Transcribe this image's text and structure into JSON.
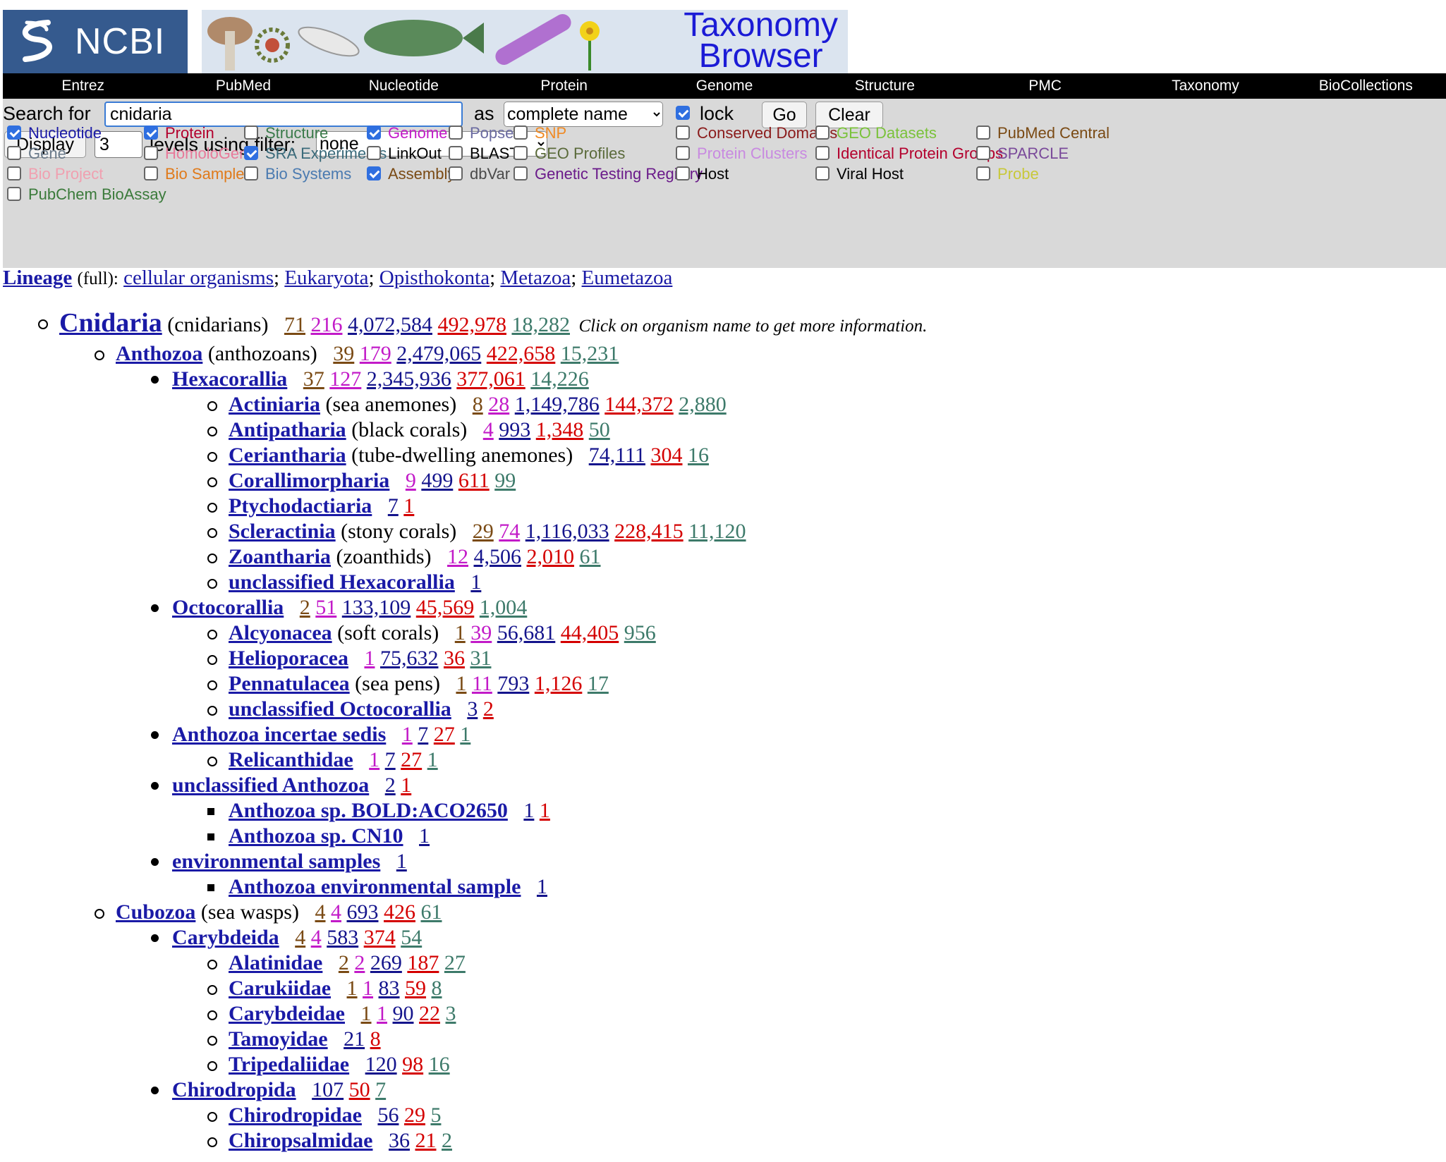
{
  "header": {
    "logo_text": "NCBI",
    "banner_title_line1": "Taxonomy",
    "banner_title_line2": "Browser"
  },
  "nav": [
    "Entrez",
    "PubMed",
    "Nucleotide",
    "Protein",
    "Genome",
    "Structure",
    "PMC",
    "Taxonomy",
    "BioCollections"
  ],
  "search": {
    "label": "Search for",
    "value": "cnidaria",
    "as_label": "as",
    "as_value": "complete name",
    "lock_label": "lock",
    "lock_checked": true,
    "go_label": "Go",
    "clear_label": "Clear"
  },
  "display": {
    "button_label": "Display",
    "levels_value": "3",
    "levels_label": "levels using filter:",
    "filter_value": "none"
  },
  "filters": [
    {
      "label": "Nucleotide",
      "checked": true,
      "color": "#1a1aa6"
    },
    {
      "label": "Protein",
      "checked": true,
      "color": "#b3002d"
    },
    {
      "label": "Structure",
      "checked": false,
      "color": "#3a7a4a"
    },
    {
      "label": "Genome",
      "checked": true,
      "color": "#c21ac8"
    },
    {
      "label": "Popset",
      "checked": false,
      "color": "#6a6aa0"
    },
    {
      "label": "SNP",
      "checked": false,
      "color": "#f08a24"
    },
    {
      "label": "Conserved Domains",
      "checked": false,
      "color": "#8a1a1a"
    },
    {
      "label": "GEO Datasets",
      "checked": false,
      "color": "#7ac23a"
    },
    {
      "label": "PubMed Central",
      "checked": false,
      "color": "#7a4a14"
    },
    {
      "label": "Gene",
      "checked": false,
      "color": "#6a7a8a"
    },
    {
      "label": "HomoloGene",
      "checked": false,
      "color": "#e87a9a"
    },
    {
      "label": "SRA Experiments",
      "checked": true,
      "color": "#3a6a7a"
    },
    {
      "label": "LinkOut",
      "checked": false,
      "color": "#000000"
    },
    {
      "label": "BLAST",
      "checked": false,
      "color": "#000000"
    },
    {
      "label": "GEO Profiles",
      "checked": false,
      "color": "#5a6a3a"
    },
    {
      "label": "Protein Clusters",
      "checked": false,
      "color": "#c88ae0"
    },
    {
      "label": "Identical Protein Groups",
      "checked": false,
      "color": "#b3002d"
    },
    {
      "label": "SPARCLE",
      "checked": false,
      "color": "#7a4a9a"
    },
    {
      "label": "Bio Project",
      "checked": false,
      "color": "#f0a0b0"
    },
    {
      "label": "Bio Sample",
      "checked": false,
      "color": "#e07a1a"
    },
    {
      "label": "Bio Systems",
      "checked": false,
      "color": "#4a7ab0"
    },
    {
      "label": "Assembly",
      "checked": true,
      "color": "#7a4a14"
    },
    {
      "label": "dbVar",
      "checked": false,
      "color": "#4a4a4a"
    },
    {
      "label": "Genetic Testing Registry",
      "checked": false,
      "color": "#6a1a8a"
    },
    {
      "label": "Host",
      "checked": false,
      "color": "#000000"
    },
    {
      "label": "Viral Host",
      "checked": false,
      "color": "#000000"
    },
    {
      "label": "Probe",
      "checked": false,
      "color": "#c8c83a"
    },
    {
      "label": "PubChem BioAssay",
      "checked": false,
      "color": "#3a7a3a"
    }
  ],
  "lineage": {
    "title": "Lineage",
    "qualifier": "(full):",
    "items": [
      "cellular organisms",
      "Eukaryota",
      "Opisthokonta",
      "Metazoa",
      "Eumetazoa"
    ]
  },
  "hint": "Click on organism name to get more information.",
  "tree": [
    {
      "name": "Cnidaria",
      "common": "(cnidarians)",
      "level": 0,
      "bullet": "circle",
      "big": true,
      "counts": [
        [
          "71",
          "brown"
        ],
        [
          "216",
          "magenta"
        ],
        [
          "4,072,584",
          "navy"
        ],
        [
          "492,978",
          "red"
        ],
        [
          "18,282",
          "green"
        ]
      ]
    },
    {
      "name": "Anthozoa",
      "common": "(anthozoans)",
      "level": 1,
      "bullet": "circle",
      "counts": [
        [
          "39",
          "brown"
        ],
        [
          "179",
          "magenta"
        ],
        [
          "2,479,065",
          "navy"
        ],
        [
          "422,658",
          "red"
        ],
        [
          "15,231",
          "green"
        ]
      ]
    },
    {
      "name": "Hexacorallia",
      "common": "",
      "level": 2,
      "bullet": "disc",
      "counts": [
        [
          "37",
          "brown"
        ],
        [
          "127",
          "magenta"
        ],
        [
          "2,345,936",
          "navy"
        ],
        [
          "377,061",
          "red"
        ],
        [
          "14,226",
          "green"
        ]
      ]
    },
    {
      "name": "Actiniaria",
      "common": "(sea anemones)",
      "level": 3,
      "bullet": "circle",
      "counts": [
        [
          "8",
          "brown"
        ],
        [
          "28",
          "magenta"
        ],
        [
          "1,149,786",
          "navy"
        ],
        [
          "144,372",
          "red"
        ],
        [
          "2,880",
          "green"
        ]
      ]
    },
    {
      "name": "Antipatharia",
      "common": "(black corals)",
      "level": 3,
      "bullet": "circle",
      "counts": [
        [
          "4",
          "magenta"
        ],
        [
          "993",
          "navy"
        ],
        [
          "1,348",
          "red"
        ],
        [
          "50",
          "green"
        ]
      ]
    },
    {
      "name": "Ceriantharia",
      "common": "(tube-dwelling anemones)",
      "level": 3,
      "bullet": "circle",
      "counts": [
        [
          "74,111",
          "navy"
        ],
        [
          "304",
          "red"
        ],
        [
          "16",
          "green"
        ]
      ]
    },
    {
      "name": "Corallimorpharia",
      "common": "",
      "level": 3,
      "bullet": "circle",
      "counts": [
        [
          "9",
          "magenta"
        ],
        [
          "499",
          "navy"
        ],
        [
          "611",
          "red"
        ],
        [
          "99",
          "green"
        ]
      ]
    },
    {
      "name": "Ptychodactiaria",
      "common": "",
      "level": 3,
      "bullet": "circle",
      "counts": [
        [
          "7",
          "navy"
        ],
        [
          "1",
          "red"
        ]
      ]
    },
    {
      "name": "Scleractinia",
      "common": "(stony corals)",
      "level": 3,
      "bullet": "circle",
      "counts": [
        [
          "29",
          "brown"
        ],
        [
          "74",
          "magenta"
        ],
        [
          "1,116,033",
          "navy"
        ],
        [
          "228,415",
          "red"
        ],
        [
          "11,120",
          "green"
        ]
      ]
    },
    {
      "name": "Zoantharia",
      "common": "(zoanthids)",
      "level": 3,
      "bullet": "circle",
      "counts": [
        [
          "12",
          "magenta"
        ],
        [
          "4,506",
          "navy"
        ],
        [
          "2,010",
          "red"
        ],
        [
          "61",
          "green"
        ]
      ]
    },
    {
      "name": "unclassified Hexacorallia",
      "common": "",
      "level": 3,
      "bullet": "circle",
      "counts": [
        [
          "1",
          "navy"
        ]
      ]
    },
    {
      "name": "Octocorallia",
      "common": "",
      "level": 2,
      "bullet": "disc",
      "counts": [
        [
          "2",
          "brown"
        ],
        [
          "51",
          "magenta"
        ],
        [
          "133,109",
          "navy"
        ],
        [
          "45,569",
          "red"
        ],
        [
          "1,004",
          "green"
        ]
      ]
    },
    {
      "name": "Alcyonacea",
      "common": "(soft corals)",
      "level": 3,
      "bullet": "circle",
      "counts": [
        [
          "1",
          "brown"
        ],
        [
          "39",
          "magenta"
        ],
        [
          "56,681",
          "navy"
        ],
        [
          "44,405",
          "red"
        ],
        [
          "956",
          "green"
        ]
      ]
    },
    {
      "name": "Helioporacea",
      "common": "",
      "level": 3,
      "bullet": "circle",
      "counts": [
        [
          "1",
          "magenta"
        ],
        [
          "75,632",
          "navy"
        ],
        [
          "36",
          "red"
        ],
        [
          "31",
          "green"
        ]
      ]
    },
    {
      "name": "Pennatulacea",
      "common": "(sea pens)",
      "level": 3,
      "bullet": "circle",
      "counts": [
        [
          "1",
          "brown"
        ],
        [
          "11",
          "magenta"
        ],
        [
          "793",
          "navy"
        ],
        [
          "1,126",
          "red"
        ],
        [
          "17",
          "green"
        ]
      ]
    },
    {
      "name": "unclassified Octocorallia",
      "common": "",
      "level": 3,
      "bullet": "circle",
      "counts": [
        [
          "3",
          "navy"
        ],
        [
          "2",
          "red"
        ]
      ]
    },
    {
      "name": "Anthozoa incertae sedis",
      "common": "",
      "level": 2,
      "bullet": "disc",
      "counts": [
        [
          "1",
          "magenta"
        ],
        [
          "7",
          "navy"
        ],
        [
          "27",
          "red"
        ],
        [
          "1",
          "green"
        ]
      ]
    },
    {
      "name": "Relicanthidae",
      "common": "",
      "level": 3,
      "bullet": "circle",
      "counts": [
        [
          "1",
          "magenta"
        ],
        [
          "7",
          "navy"
        ],
        [
          "27",
          "red"
        ],
        [
          "1",
          "green"
        ]
      ]
    },
    {
      "name": "unclassified Anthozoa",
      "common": "",
      "level": 2,
      "bullet": "disc",
      "counts": [
        [
          "2",
          "navy"
        ],
        [
          "1",
          "red"
        ]
      ]
    },
    {
      "name": "Anthozoa sp. BOLD:ACO2650",
      "common": "",
      "level": 3,
      "bullet": "square",
      "counts": [
        [
          "1",
          "navy"
        ],
        [
          "1",
          "red"
        ]
      ]
    },
    {
      "name": "Anthozoa sp. CN10",
      "common": "",
      "level": 3,
      "bullet": "square",
      "counts": [
        [
          "1",
          "navy"
        ]
      ]
    },
    {
      "name": "environmental samples",
      "common": "",
      "level": 2,
      "bullet": "disc",
      "counts": [
        [
          "1",
          "navy"
        ]
      ]
    },
    {
      "name": "Anthozoa environmental sample",
      "common": "",
      "level": 3,
      "bullet": "square",
      "counts": [
        [
          "1",
          "navy"
        ]
      ]
    },
    {
      "name": "Cubozoa",
      "common": "(sea wasps)",
      "level": 1,
      "bullet": "circle",
      "counts": [
        [
          "4",
          "brown"
        ],
        [
          "4",
          "magenta"
        ],
        [
          "693",
          "navy"
        ],
        [
          "426",
          "red"
        ],
        [
          "61",
          "green"
        ]
      ]
    },
    {
      "name": "Carybdeida",
      "common": "",
      "level": 2,
      "bullet": "disc",
      "counts": [
        [
          "4",
          "brown"
        ],
        [
          "4",
          "magenta"
        ],
        [
          "583",
          "navy"
        ],
        [
          "374",
          "red"
        ],
        [
          "54",
          "green"
        ]
      ]
    },
    {
      "name": "Alatinidae",
      "common": "",
      "level": 3,
      "bullet": "circle",
      "counts": [
        [
          "2",
          "brown"
        ],
        [
          "2",
          "magenta"
        ],
        [
          "269",
          "navy"
        ],
        [
          "187",
          "red"
        ],
        [
          "27",
          "green"
        ]
      ]
    },
    {
      "name": "Carukiidae",
      "common": "",
      "level": 3,
      "bullet": "circle",
      "counts": [
        [
          "1",
          "brown"
        ],
        [
          "1",
          "magenta"
        ],
        [
          "83",
          "navy"
        ],
        [
          "59",
          "red"
        ],
        [
          "8",
          "green"
        ]
      ]
    },
    {
      "name": "Carybdeidae",
      "common": "",
      "level": 3,
      "bullet": "circle",
      "counts": [
        [
          "1",
          "brown"
        ],
        [
          "1",
          "magenta"
        ],
        [
          "90",
          "navy"
        ],
        [
          "22",
          "red"
        ],
        [
          "3",
          "green"
        ]
      ]
    },
    {
      "name": "Tamoyidae",
      "common": "",
      "level": 3,
      "bullet": "circle",
      "counts": [
        [
          "21",
          "navy"
        ],
        [
          "8",
          "red"
        ]
      ]
    },
    {
      "name": "Tripedaliidae",
      "common": "",
      "level": 3,
      "bullet": "circle",
      "counts": [
        [
          "120",
          "navy"
        ],
        [
          "98",
          "red"
        ],
        [
          "16",
          "green"
        ]
      ]
    },
    {
      "name": "Chirodropida",
      "common": "",
      "level": 2,
      "bullet": "disc",
      "counts": [
        [
          "107",
          "navy"
        ],
        [
          "50",
          "red"
        ],
        [
          "7",
          "green"
        ]
      ]
    },
    {
      "name": "Chirodropidae",
      "common": "",
      "level": 3,
      "bullet": "circle",
      "counts": [
        [
          "56",
          "navy"
        ],
        [
          "29",
          "red"
        ],
        [
          "5",
          "green"
        ]
      ]
    },
    {
      "name": "Chiropsalmidae",
      "common": "",
      "level": 3,
      "bullet": "circle",
      "counts": [
        [
          "36",
          "navy"
        ],
        [
          "21",
          "red"
        ],
        [
          "2",
          "green"
        ]
      ]
    }
  ]
}
